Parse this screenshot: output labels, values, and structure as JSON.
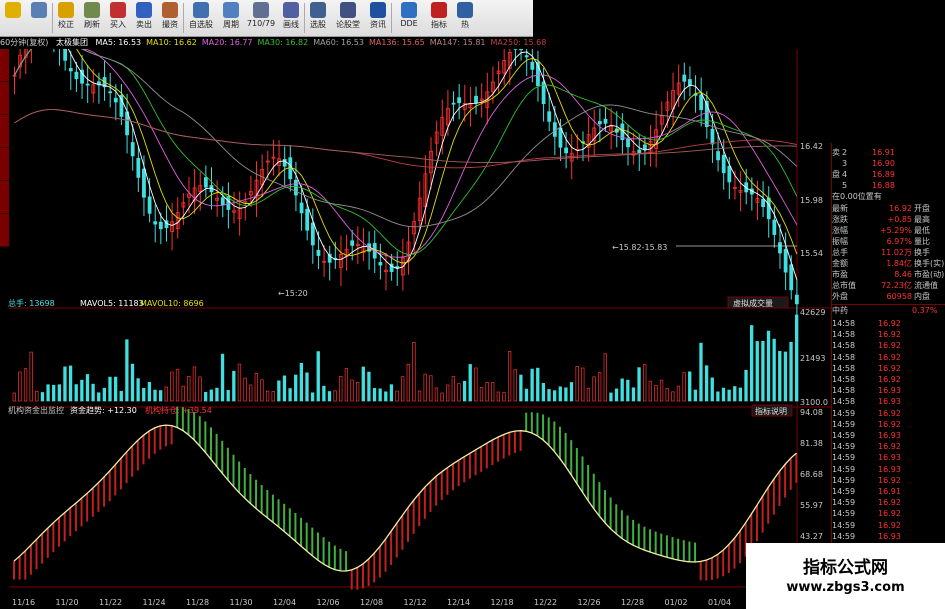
{
  "toolbar": {
    "buttons": [
      {
        "label": "",
        "icon": "back-arrow-icon",
        "color": "#e0b000"
      },
      {
        "label": "",
        "icon": "home-icon",
        "color": "#5a7fb4"
      },
      {
        "label": "校正",
        "icon": "refresh-icon",
        "color": "#d8a000"
      },
      {
        "label": "刷新",
        "icon": "clock-icon",
        "color": "#6f8a4a"
      },
      {
        "label": "买入",
        "icon": "buy-icon",
        "color": "#c03030"
      },
      {
        "label": "卖出",
        "icon": "sell-icon",
        "color": "#3060c0"
      },
      {
        "label": "撮资",
        "icon": "hand-icon",
        "color": "#b06030"
      },
      {
        "label": "自选股",
        "icon": "favorites-icon",
        "color": "#4070b0"
      },
      {
        "label": "周期",
        "icon": "cycle-icon",
        "color": "#5080c0"
      },
      {
        "label": "710/79",
        "icon": "chart-icon",
        "color": "#607090"
      },
      {
        "label": "画线",
        "icon": "pen-icon",
        "color": "#5060a0"
      },
      {
        "label": "选股",
        "icon": "screen-icon",
        "color": "#406090"
      },
      {
        "label": "论股堂",
        "icon": "forum-icon",
        "color": "#405080"
      },
      {
        "label": "资讯",
        "icon": "news-icon",
        "color": "#2050a0"
      },
      {
        "label": "DDE",
        "icon": "funds-icon",
        "color": "#3070c0"
      },
      {
        "label": "指标",
        "icon": "indicator-icon",
        "color": "#c02020"
      },
      {
        "label": "热",
        "icon": "hot-icon",
        "color": "#3060a0"
      }
    ],
    "news_label": "NEWS",
    "funds_label": "资金",
    "dde_label": "DDE"
  },
  "chart_header": {
    "period": "60分钟(复权)",
    "name": "太极集团",
    "ma": [
      {
        "label": "MA5: 16.53",
        "color": "#ffffff"
      },
      {
        "label": "MA10: 16.62",
        "color": "#e0e000"
      },
      {
        "label": "MA20: 16.77",
        "color": "#e060e0"
      },
      {
        "label": "MA30: 16.82",
        "color": "#30c030"
      },
      {
        "label": "MA60: 16.53",
        "color": "#a0a0a0"
      },
      {
        "label": "MA136: 15.65",
        "color": "#e06060"
      },
      {
        "label": "MA147: 15.81",
        "color": "#c08080"
      },
      {
        "label": "MA250: 15.68",
        "color": "#c04040"
      }
    ]
  },
  "price_axis": [
    "16.42",
    "15.98",
    "15.54"
  ],
  "annotations": {
    "low": "15:20",
    "range": "15.82-15.83"
  },
  "volume_header": {
    "total": "总手: 13698",
    "mavol5": "MAVOL5: 11183",
    "mavol10": "MAVOL10: 8696"
  },
  "volume_button": "虚拟成交量",
  "volume_axis": [
    "42629",
    "21493",
    "3100.0"
  ],
  "indicator_header": {
    "name": "机构资金出监控",
    "trend": "资金趋势: +12.30",
    "line2": "机构持仓: +39.54"
  },
  "indicator_button": "指标说明",
  "indicator_axis": [
    "94.08",
    "81.38",
    "68.68",
    "55.97",
    "43.27",
    "30.57"
  ],
  "date_axis": [
    "11/16",
    "11/20",
    "11/22",
    "11/24",
    "11/28",
    "11/30",
    "12/04",
    "12/06",
    "12/08",
    "12/12",
    "12/14",
    "12/18",
    "12/22",
    "12/26",
    "12/28",
    "01/02",
    "01/04",
    "01/08"
  ],
  "order_book": [
    {
      "label": "卖",
      "lvl": "2",
      "price": "16.91"
    },
    {
      "label": "",
      "lvl": "3",
      "price": "16.90"
    },
    {
      "label": "盘",
      "lvl": "4",
      "price": "16.89"
    },
    {
      "label": "",
      "lvl": "5",
      "price": "16.88"
    }
  ],
  "position_label": "在0.00位置有",
  "quote": [
    {
      "k": "最新",
      "v": "16.92",
      "k2": "开盘"
    },
    {
      "k": "涨跌",
      "v": "+0.85",
      "k2": "最高"
    },
    {
      "k": "涨幅",
      "v": "+5.29%",
      "k2": "最低"
    },
    {
      "k": "振幅",
      "v": "6.97%",
      "k2": "量比"
    },
    {
      "k": "总手",
      "v": "11.02万",
      "k2": "换手"
    },
    {
      "k": "金额",
      "v": "1.84亿",
      "k2": "换手(实)"
    },
    {
      "k": "市盈",
      "v": "8.46",
      "k2": "市盈(动)"
    },
    {
      "k": "总市值",
      "v": "72.23亿",
      "k2": "流通值"
    },
    {
      "k": "外盘",
      "v": "60958",
      "k2": "内盘"
    }
  ],
  "ticks_header": {
    "label": "中药",
    "value": "0.37%"
  },
  "ticks": [
    {
      "t": "14:58",
      "p": "16.92"
    },
    {
      "t": "14:58",
      "p": "16.92"
    },
    {
      "t": "14:58",
      "p": "16.92"
    },
    {
      "t": "14:58",
      "p": "16.92"
    },
    {
      "t": "14:58",
      "p": "16.92"
    },
    {
      "t": "14:58",
      "p": "16.92"
    },
    {
      "t": "14:58",
      "p": "16.93"
    },
    {
      "t": "14:58",
      "p": "16.93"
    },
    {
      "t": "14:59",
      "p": "16.92"
    },
    {
      "t": "14:59",
      "p": "16.92"
    },
    {
      "t": "14:59",
      "p": "16.93"
    },
    {
      "t": "14:59",
      "p": "16.92"
    },
    {
      "t": "14:59",
      "p": "16.93"
    },
    {
      "t": "14:59",
      "p": "16.93"
    },
    {
      "t": "14:59",
      "p": "16.92"
    },
    {
      "t": "14:59",
      "p": "16.91"
    },
    {
      "t": "14:59",
      "p": "16.92"
    },
    {
      "t": "14:59",
      "p": "16.92"
    },
    {
      "t": "14:59",
      "p": "16.92"
    },
    {
      "t": "14:59",
      "p": "16.93"
    },
    {
      "t": "14:59",
      "p": "16.92"
    },
    {
      "t": "14:59",
      "p": "16.93"
    }
  ],
  "watermark": {
    "title": "指标公式网",
    "url": "www.zbgs3.com"
  },
  "colors": {
    "up": "#ff3030",
    "down": "#40e0e0",
    "grid": "#7a0000",
    "ma_white": "#ffffff",
    "ma_yellow": "#e0e000",
    "ma_purple": "#e060e0",
    "ma_green": "#30c030"
  }
}
